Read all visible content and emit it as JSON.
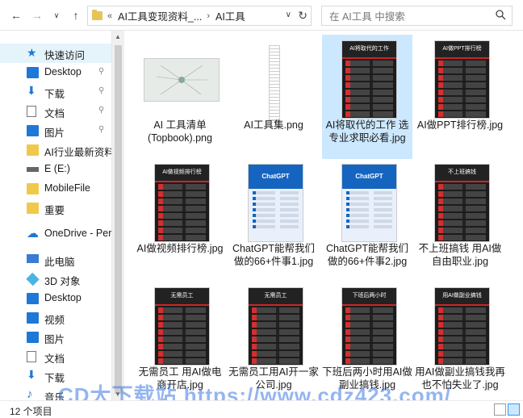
{
  "toolbar": {
    "back_icon": "←",
    "forward_icon": "→",
    "dropdown_icon": "∨",
    "up_icon": "↑",
    "breadcrumb_overflow": "«",
    "breadcrumb": [
      "AI工具变现资料_...",
      "AI工具"
    ],
    "breadcrumb_sep": "›",
    "address_dropdown": "∨",
    "refresh_icon": "↻",
    "search_placeholder": "在 AI工具 中搜索"
  },
  "sidebar": {
    "items": [
      {
        "label": "快速访问",
        "icon": "star-icon",
        "pinned": false,
        "selected": true
      },
      {
        "label": "Desktop",
        "icon": "desktop-icon",
        "pinned": true
      },
      {
        "label": "下载",
        "icon": "download-icon",
        "pinned": true
      },
      {
        "label": "文档",
        "icon": "document-icon",
        "pinned": true
      },
      {
        "label": "图片",
        "icon": "pictures-icon",
        "pinned": true
      },
      {
        "label": "AI行业最新资料",
        "icon": "folder-icon",
        "pinned": false
      },
      {
        "label": "E (E:)",
        "icon": "drive-icon",
        "pinned": false
      },
      {
        "label": "MobileFile",
        "icon": "folder-icon",
        "pinned": false
      },
      {
        "label": "重要",
        "icon": "folder-icon",
        "pinned": false
      },
      {
        "label": "OneDrive - Pers",
        "icon": "cloud-icon",
        "pinned": false
      },
      {
        "label": "此电脑",
        "icon": "computer-icon",
        "pinned": false
      },
      {
        "label": "3D 对象",
        "icon": "3d-objects-icon",
        "pinned": false
      },
      {
        "label": "Desktop",
        "icon": "desktop-icon",
        "pinned": false
      },
      {
        "label": "视频",
        "icon": "video-icon",
        "pinned": false
      },
      {
        "label": "图片",
        "icon": "pictures-icon",
        "pinned": false
      },
      {
        "label": "文档",
        "icon": "document-icon",
        "pinned": false
      },
      {
        "label": "下载",
        "icon": "download-icon",
        "pinned": false
      },
      {
        "label": "音乐",
        "icon": "music-icon",
        "pinned": false
      }
    ],
    "pin_icon": "📌"
  },
  "files": [
    {
      "name": "AI 工具清单(Topbook).png",
      "thumb": "mindmap",
      "selected": false
    },
    {
      "name": "AI工具集.png",
      "thumb": "strip",
      "selected": false
    },
    {
      "name": "AI将取代的工作 选专业求职必看.jpg",
      "thumb": "dark",
      "thumb_title": "AI将取代的工作",
      "selected": true
    },
    {
      "name": "AI做PPT排行榜.jpg",
      "thumb": "dark",
      "thumb_title": "AI做PPT排行榜",
      "selected": false
    },
    {
      "name": "AI做视频排行榜.jpg",
      "thumb": "dark",
      "thumb_title": "AI做视频排行榜",
      "selected": false
    },
    {
      "name": "ChatGPT能帮我们做的66+件事1.jpg",
      "thumb": "blue",
      "thumb_title": "ChatGPT",
      "selected": false
    },
    {
      "name": "ChatGPT能帮我们做的66+件事2.jpg",
      "thumb": "blue",
      "thumb_title": "ChatGPT",
      "selected": false
    },
    {
      "name": "不上班搞钱 用AI做自由职业.jpg",
      "thumb": "dark",
      "thumb_title": "不上班搞钱",
      "selected": false
    },
    {
      "name": "无需员工 用AI做电商开店.jpg",
      "thumb": "dark",
      "thumb_title": "无需员工",
      "selected": false
    },
    {
      "name": "无需员工用AI开一家公司.jpg",
      "thumb": "dark",
      "thumb_title": "无需员工",
      "selected": false
    },
    {
      "name": "下班后两小时用AI做副业搞钱.jpg",
      "thumb": "dark",
      "thumb_title": "下班后两小时",
      "selected": false
    },
    {
      "name": "用AI做副业搞钱我再也不怕失业了.jpg",
      "thumb": "dark",
      "thumb_title": "用AI做副业搞钱",
      "selected": false
    }
  ],
  "status": {
    "count": "12 个项目"
  },
  "watermark": "CD大下载站 https://www.cdz423.com/"
}
